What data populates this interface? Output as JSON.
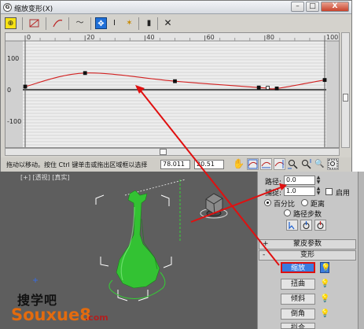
{
  "dialog": {
    "title": "缩放变形(X)",
    "window_buttons": {
      "minimize": "–",
      "maximize": "□",
      "close": "X"
    }
  },
  "toolbar": {
    "icons": [
      "lock-aspect-icon",
      "corner-point-icon",
      "bezier-point-icon",
      "make-curve-icon",
      "move-control-point-icon",
      "scale-control-point-icon",
      "insert-corner-point-icon",
      "delete-control-point-icon",
      "reset-curve-icon"
    ],
    "glyphs": {
      "lock": "⊕",
      "curve": "〜",
      "move": "✥",
      "scale": "I",
      "insert": "✶",
      "delete_point": "▮",
      "reset": "✕"
    }
  },
  "graph": {
    "ruler_ticks": [
      "0",
      "20",
      "40",
      "60",
      "80",
      "100"
    ],
    "y_labels": [
      "100",
      "0",
      "-100"
    ],
    "curve_color": "#d22222",
    "control_points": [
      {
        "path_pct": 0,
        "value": 10
      },
      {
        "path_pct": 20,
        "value": 53
      },
      {
        "path_pct": 50,
        "value": 27
      },
      {
        "path_pct": 78,
        "value": 7
      },
      {
        "path_pct": 81,
        "value": 6
      },
      {
        "path_pct": 84,
        "value": 4
      },
      {
        "path_pct": 100,
        "value": 31
      }
    ]
  },
  "status": {
    "hint": "拖动以移动。按住 Ctrl 键单击或拖出区域框以选择",
    "x_value": "78.011",
    "y_value": "20.51",
    "icons": [
      "pan-icon",
      "zoom-extents-icon",
      "zoom-horizontal-extents-icon",
      "zoom-vertical-extents-icon",
      "zoom-horizontal-icon",
      "zoom-vertical-icon",
      "zoom-icon",
      "zoom-region-icon"
    ],
    "glyphs": {
      "pan": "✋",
      "zoom": "🔍"
    }
  },
  "viewport": {
    "label": "[+] [透视] [真实]",
    "object_color": "#33c233",
    "background_color": "#5e5e5e"
  },
  "command_panel": {
    "path_label": "路径:",
    "path_value": "0.0",
    "snap_label": "捕捉:",
    "snap_value": "1.0",
    "enable_label": "启用",
    "percent_label": "百分比",
    "distance_label": "距离",
    "path_steps_label": "路径步数",
    "skin_params_label": "蒙皮参数",
    "deformations_label": "变形",
    "rollout_plus": "+",
    "rollout_minus": "-",
    "deform_buttons": [
      "缩放",
      "扭曲",
      "倾斜",
      "倒角",
      "拟合"
    ],
    "bulb_glyph": "💡"
  },
  "watermark": {
    "chinese": "搜学吧",
    "english": "Souxue8",
    "suffix": ".com"
  },
  "annotation": {
    "arrow_color": "#e01010"
  }
}
